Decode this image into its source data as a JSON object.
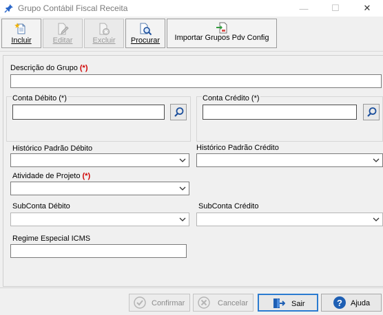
{
  "window": {
    "title": "Grupo Contábil Fiscal Receita",
    "minimize_glyph": "—",
    "maximize_glyph": "☐",
    "close_glyph": "✕"
  },
  "toolbar": {
    "incluir": "Incluir",
    "editar": "Editar",
    "excluir": "Excluir",
    "procurar": "Procurar",
    "importar": "Importar Grupos Pdv Config"
  },
  "form": {
    "required_mark": "(*)",
    "descricao_label": "Descrição do Grupo",
    "descricao_value": "",
    "conta_debito_label": "Conta Débito (*)",
    "conta_debito_value": "",
    "conta_credito_label": "Conta Crédito (*)",
    "conta_credito_value": "",
    "historico_debito_label": "Histórico Padrão Débito",
    "historico_debito_value": "",
    "historico_credito_label": "Histórico Padrão Crédito",
    "historico_credito_value": "",
    "atividade_label": "Atividade de Projeto",
    "atividade_value": "",
    "subconta_debito_label": "SubConta Débito",
    "subconta_debito_value": "",
    "subconta_credito_label": "SubConta Crédito",
    "subconta_credito_value": "",
    "regime_label": "Regime Especial ICMS",
    "regime_value": ""
  },
  "footer": {
    "confirmar": "Confirmar",
    "cancelar": "Cancelar",
    "sair": "Sair",
    "ajuda": "Ajuda"
  },
  "colors": {
    "required": "#d00000",
    "focus_border": "#2b7bd0",
    "help_icon": "#1e5fb4"
  },
  "icons": [
    "pin-icon",
    "new-document-icon",
    "edit-document-icon",
    "delete-document-icon",
    "search-document-icon",
    "import-icon",
    "search-icon",
    "chevron-down-icon",
    "check-icon",
    "cancel-icon",
    "exit-icon",
    "help-icon"
  ]
}
